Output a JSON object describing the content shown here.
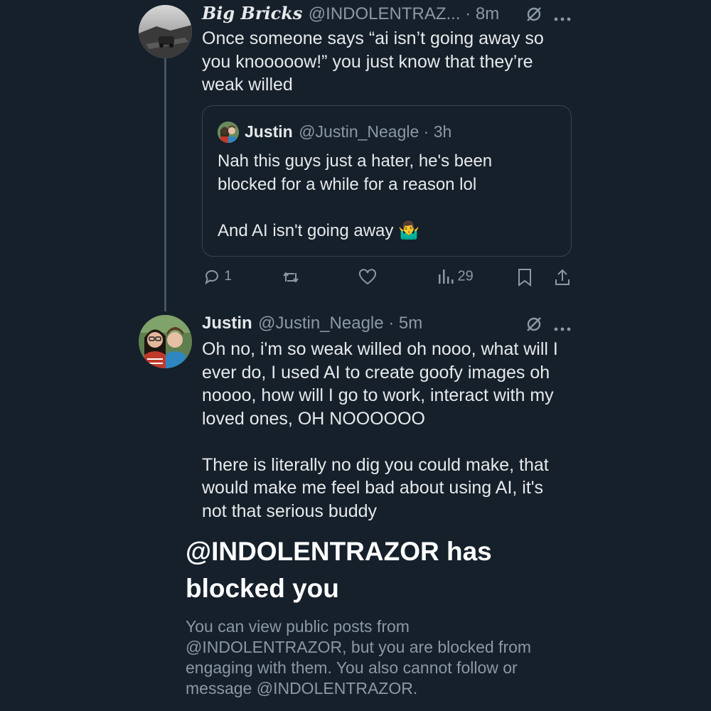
{
  "tweet1": {
    "display_name": "Big Bricks",
    "handle_time": "@INDOLENTRAZ... · 8m",
    "text": "Once someone says “ai isn’t going away so\nyou knooooow!” you just know that they’re\nweak willed",
    "quote": {
      "display_name": "Justin",
      "handle_time": "@Justin_Neagle · 3h",
      "text": "Nah this guys just a hater, he's been\nblocked for a while for a reason lol\n\nAnd AI isn't going away 🤷‍♂️"
    },
    "actions": {
      "replies": "1",
      "views": "29"
    }
  },
  "tweet2": {
    "display_name": "Justin",
    "handle_time": "@Justin_Neagle · 5m",
    "text": "Oh no, i'm so weak willed oh nooo, what will I\never do, I used AI to create goofy images oh\nnoooo, how will I go to work, interact with my\nloved ones, OH NOOOOOO\n\nThere is literally no dig you could make, that\nwould make me feel bad about using AI, it's\nnot that serious buddy"
  },
  "blocked": {
    "title": "@INDOLENTRAZOR has\nblocked you",
    "description": "You can view public posts from\n@INDOLENTRAZOR, but you are blocked from\nengaging with them. You also cannot follow or\nmessage @INDOLENTRAZOR."
  },
  "colors": {
    "background": "#15202b",
    "text": "#e7e9ea",
    "secondary": "#8b98a5",
    "border": "#38444d"
  }
}
